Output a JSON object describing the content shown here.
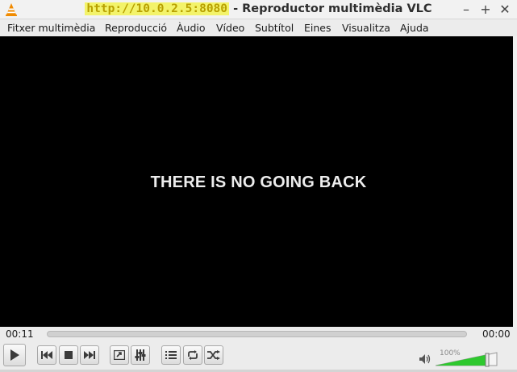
{
  "window": {
    "title_url": "http://10.0.2.5:8080",
    "title_rest": " - Reproductor multimèdia VLC",
    "minimize_glyph": "–",
    "maximize_glyph": "+",
    "close_glyph": "✕"
  },
  "menu": [
    "Fitxer multimèdia",
    "Reproducció",
    "Àudio",
    "Vídeo",
    "Subtítol",
    "Eines",
    "Visualitza",
    "Ajuda"
  ],
  "video": {
    "caption": "THERE IS NO GOING BACK"
  },
  "seek": {
    "elapsed": "00:11",
    "total": "00:00",
    "progress": 0
  },
  "volume": {
    "label": "100%",
    "level": 1.0
  },
  "colors": {
    "url_highlight": "#f3f36a",
    "volume_green": "#2ec82e",
    "vlc_orange": "#f08a00"
  },
  "icons": {
    "app": "vlc-cone-icon",
    "play": "play-icon",
    "prev": "skip-previous-icon",
    "stop": "stop-icon",
    "next": "skip-next-icon",
    "fullscreen": "fullscreen-icon",
    "extended": "extended-settings-icon",
    "playlist": "playlist-icon",
    "loop": "loop-icon",
    "random": "shuffle-icon",
    "speaker": "speaker-icon"
  }
}
